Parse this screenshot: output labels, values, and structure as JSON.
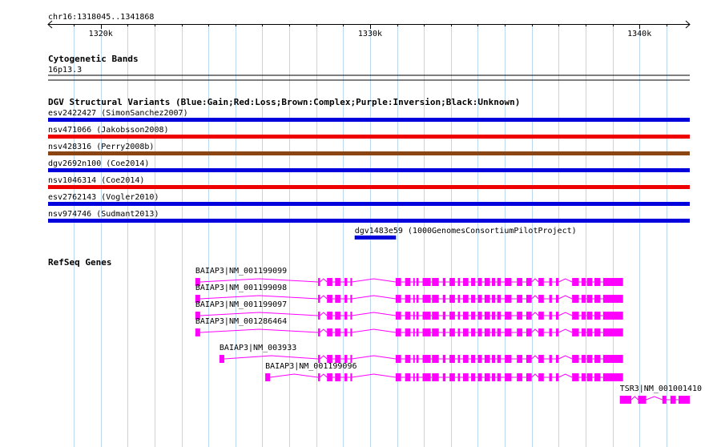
{
  "ruler": {
    "region_label": "chr16:1318045..1341868",
    "region_start": 1318045,
    "region_end": 1341868,
    "ticks": [
      {
        "pos": 1320000,
        "label": "1320k"
      },
      {
        "pos": 1330000,
        "label": "1330k"
      },
      {
        "pos": 1340000,
        "label": "1340k"
      }
    ]
  },
  "tracks": {
    "cytoband": {
      "title": "Cytogenetic Bands",
      "band_label": "16p13.3"
    },
    "dgv": {
      "title": "DGV Structural Variants (Blue:Gain;Red:Loss;Brown:Complex;Purple:Inversion;Black:Unknown)",
      "variants": [
        {
          "label": "esv2422427 (SimonSanchez2007)",
          "start": 1318045,
          "end": 1341868,
          "color": "#0000dd"
        },
        {
          "label": "nsv471066 (Jakobsson2008)",
          "start": 1318045,
          "end": 1341868,
          "color": "#ee0000"
        },
        {
          "label": "nsv428316 (Perry2008b)",
          "start": 1318045,
          "end": 1341868,
          "color": "#8b4513"
        },
        {
          "label": "dgv2692n100 (Coe2014)",
          "start": 1318045,
          "end": 1341868,
          "color": "#0000dd"
        },
        {
          "label": "nsv1046314 (Coe2014)",
          "start": 1318045,
          "end": 1341868,
          "color": "#ee0000"
        },
        {
          "label": "esv2762143 (Vogler2010)",
          "start": 1318045,
          "end": 1341868,
          "color": "#0000dd"
        },
        {
          "label": "nsv974746 (Sudmant2013)",
          "start": 1318045,
          "end": 1341868,
          "color": "#0000dd"
        },
        {
          "label": "dgv1483e59 (1000GenomesConsortiumPilotProject)",
          "start": 1329427,
          "end": 1330962,
          "color": "#0000dd"
        }
      ]
    },
    "refseq": {
      "title": "RefSeq Genes",
      "color": "#ff00ff",
      "genes": [
        {
          "label": "BAIAP3|NM_001199099",
          "start": 1323512,
          "end": 1339391
        },
        {
          "label": "BAIAP3|NM_001199098",
          "start": 1323512,
          "end": 1339391
        },
        {
          "label": "BAIAP3|NM_001199097",
          "start": 1323512,
          "end": 1339391
        },
        {
          "label": "BAIAP3|NM_001286464",
          "start": 1323512,
          "end": 1339391
        },
        {
          "label": "BAIAP3|NM_003933",
          "start": 1324407,
          "end": 1339391
        },
        {
          "label": "BAIAP3|NM_001199096",
          "start": 1326108,
          "end": 1339391
        },
        {
          "label": "TSR3|NM_001001410",
          "start": 1339272,
          "end": 1341868
        }
      ]
    }
  }
}
